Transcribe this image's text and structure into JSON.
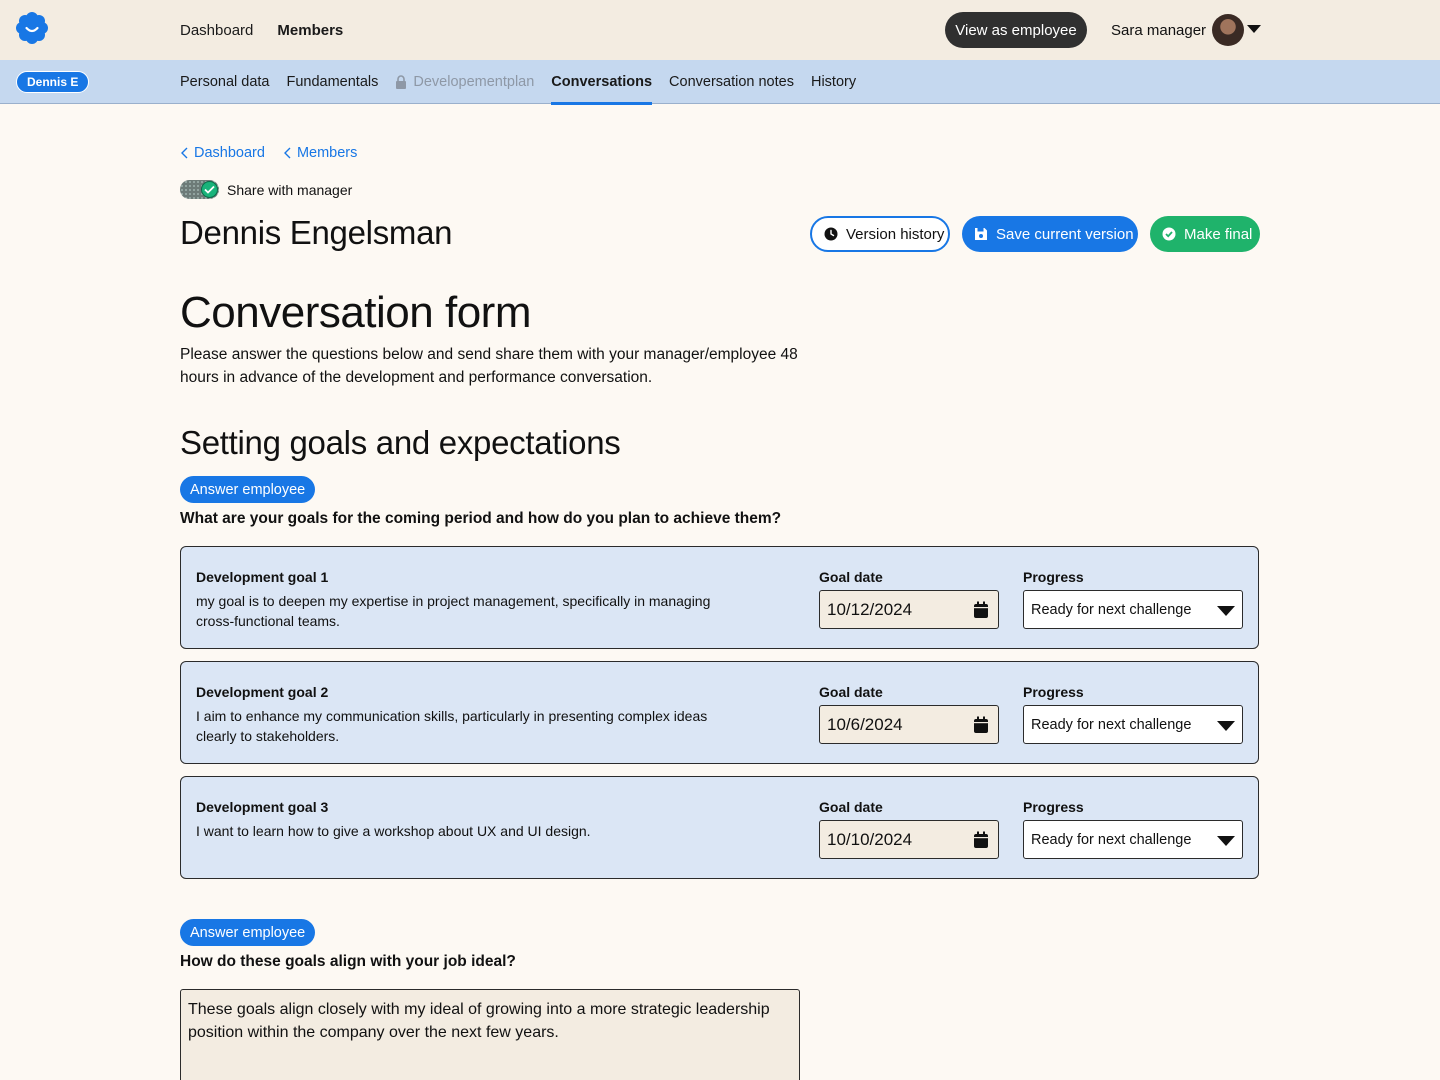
{
  "topbar": {
    "nav": [
      {
        "label": "Dashboard",
        "active": false
      },
      {
        "label": "Members",
        "active": true
      }
    ],
    "view_as_employee": "View as employee",
    "user_name": "Sara manager"
  },
  "subbar": {
    "person_pill": "Dennis E",
    "tabs": [
      {
        "label": "Personal data"
      },
      {
        "label": "Fundamentals"
      },
      {
        "label": "Developementplan",
        "locked": true
      },
      {
        "label": "Conversations",
        "active": true
      },
      {
        "label": "Conversation notes"
      },
      {
        "label": "History"
      }
    ]
  },
  "breadcrumbs": [
    "Dashboard",
    "Members"
  ],
  "share_toggle": {
    "label": "Share with manager",
    "on": true
  },
  "person_name": "Dennis Engelsman",
  "actions": {
    "version_history": "Version history",
    "save_current_version": "Save current version",
    "make_final": "Make final"
  },
  "form": {
    "title": "Conversation form",
    "description": "Please answer the questions below and send share them with your manager/employee 48 hours in advance of the development and performance conversation."
  },
  "section": {
    "title": "Setting goals and expectations",
    "q1": {
      "badge": "Answer employee",
      "question": "What are your goals for the coming period and how do you plan to achieve them?",
      "goal_date_label": "Goal date",
      "progress_label": "Progress",
      "goals": [
        {
          "name": "Development goal 1",
          "text": "my goal is to deepen my expertise in project management, specifically in managing cross-functional teams.",
          "date": "10/12/2024",
          "progress": "Ready for next challenge"
        },
        {
          "name": "Development goal 2",
          "text": "I aim to enhance my communication skills, particularly in presenting complex ideas clearly to stakeholders.",
          "date": "10/6/2024",
          "progress": "Ready for next challenge"
        },
        {
          "name": "Development goal 3",
          "text": "I want to learn how to give a workshop about UX and UI design.",
          "date": "10/10/2024",
          "progress": "Ready for next challenge"
        }
      ]
    },
    "q2": {
      "badge": "Answer employee",
      "question": "How do these goals align with your job ideal?",
      "answer": "These goals align closely with my ideal of growing into a more strategic leadership position within the company over the next few years."
    }
  },
  "colors": {
    "primary": "#1877e5",
    "success": "#1fb36b",
    "topbar_bg": "#f3ece1",
    "subbar_bg": "#c5d8ef",
    "card_bg": "#dbe6f5"
  }
}
